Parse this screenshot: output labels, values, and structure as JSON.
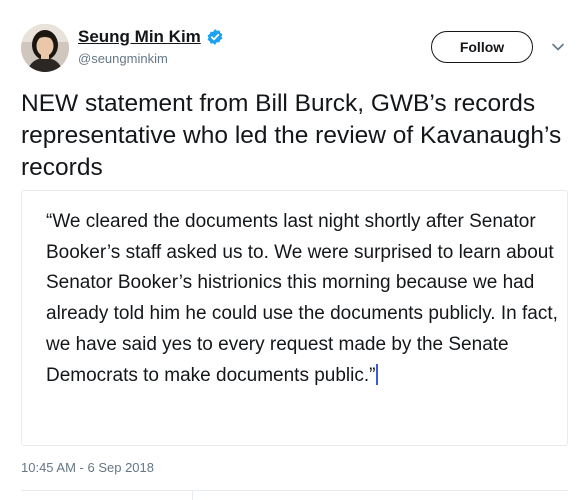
{
  "author": {
    "name": "Seung Min Kim",
    "handle": "@seungminkim",
    "verified": true,
    "avatar_icon": "profile-photo"
  },
  "actions": {
    "follow_label": "Follow",
    "menu_icon": "chevron-down-icon"
  },
  "tweet": {
    "text": "NEW statement from Bill Burck, GWB’s records representative who led the review of Kavanaugh’s records",
    "quote": "“We cleared the documents last night shortly after Senator Booker’s staff asked us to.  We were surprised to learn about Senator Booker’s histrionics this morning because we had already told him he could use the documents publicly.  In fact, we have said yes to every request made by the Senate Democrats to make documents public.”",
    "timestamp": "10:45 AM - 6 Sep 2018"
  },
  "colors": {
    "verified": "#1da1f2",
    "text": "#14171a",
    "muted": "#657786",
    "border": "#e6ecf0",
    "caret": "#3b5bdb"
  }
}
